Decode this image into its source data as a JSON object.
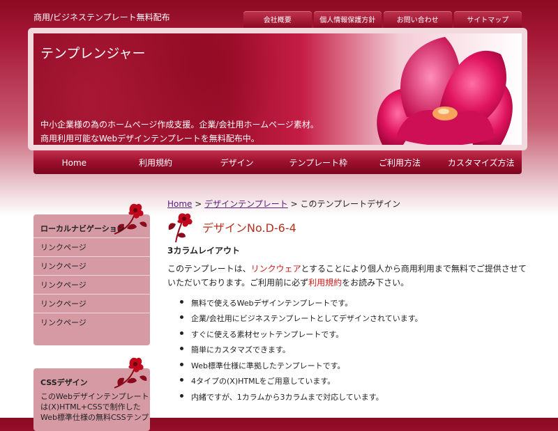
{
  "header": {
    "tagline": "商用/ビジネステンプレート無料配布",
    "site_title": "テンプレンジャー",
    "description_lines": [
      "中小企業様の為のホームページ作成支援。企業/会社用ホームページ素材。",
      "商用利用可能なWebデザインテンプレートを無料配布中。"
    ]
  },
  "top_nav": [
    "会社概要",
    "個人情報保護方針",
    "お問い合わせ",
    "サイトマップ"
  ],
  "main_nav": [
    "Home",
    "利用規約",
    "デザイン",
    "テンプレート枠",
    "ご利用方法",
    "カスタマイズ方法"
  ],
  "sidebar": {
    "local_nav": {
      "title": "ローカルナビゲーション",
      "items": [
        "リンクページ",
        "リンクページ",
        "リンクページ",
        "リンクページ",
        "リンクページ"
      ]
    },
    "css_box": {
      "title": "CSSデザイン",
      "lines": [
        "このWebデザインテンプレート",
        "は(X)HTML+CSSで制作した",
        "Web標準仕様の無料CSSテンプ"
      ]
    }
  },
  "main": {
    "breadcrumb": {
      "home": "Home",
      "sep1": " > ",
      "design": "デザインテンプレート",
      "sep2": " > ",
      "current": "このテンプレートデザイン"
    },
    "title": "デザインNo.D-6-4",
    "subtitle": "3カラムレイアウト",
    "intro": {
      "part1": "このテンプレートは、",
      "link1": "リンクウェア",
      "part2": "とすることにより個人から商用利用まで無料でご提供させて",
      "part3": "いただいております。ご利用前に必ず",
      "link2": "利用規約",
      "part4": "をお読み下さい。"
    },
    "bullets": [
      "無料で使えるWebデザインテンプレートです。",
      "企業/会社用にビジネステンプレートとしてデザインされています。",
      "すぐに使える素材セットテンプレートです。",
      "簡単にカスタマズできます。",
      "Web標準仕様に準拠したテンプレートです。",
      "4タイプの(X)HTMLをご用意しています。",
      "内緒ですが、1カラムから3カラムまで対応しています。"
    ]
  },
  "colors": {
    "brand": "#8c0a22",
    "accent_red": "#d01818",
    "heading": "#b5301f",
    "sidebar_bg": "#d59aa3"
  },
  "icons": [
    "tulip-photo",
    "red-flower-icon"
  ]
}
